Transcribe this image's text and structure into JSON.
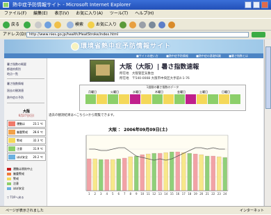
{
  "window": {
    "title": "熱中症予防情報サイト - Microsoft Internet Explorer",
    "menu": [
      "ファイル(F)",
      "編集(E)",
      "表示(V)",
      "お気に入り(A)",
      "ツール(T)",
      "ヘルプ(H)"
    ]
  },
  "toolbar": {
    "back_label": "戻る",
    "search_label": "検索",
    "favorites_label": "お気に入り"
  },
  "address": {
    "label": "アドレス(D)",
    "url": "http://www.nies.go.jp/health/HeatStroke/index.html"
  },
  "banner": {
    "site_title": "環境省熱中症予防情報サイト",
    "nav": [
      "■サイトの使い方",
      "■熱中症予防情報",
      "■熱中症の基礎知識",
      "■暑さ指数とは"
    ]
  },
  "sidebar": {
    "links": [
      "暑さ指数の概要",
      "都道府県別",
      "地点一覧",
      "暑さ指数情報",
      "過去の観測値",
      "熱中症の予防"
    ],
    "city": "大阪",
    "date": "6月27日(日)",
    "heat_rows": [
      {
        "label": "運動は",
        "value": "23.1 ℃"
      },
      {
        "label": "厳重警戒",
        "value": "28.6 ℃"
      },
      {
        "label": "警戒",
        "value": "32.3 ℃"
      },
      {
        "label": "注意",
        "value": "31.9 ℃"
      },
      {
        "label": "ほぼ安全",
        "value": "20.2 ℃"
      }
    ],
    "legend": [
      "運動は原則中止",
      "厳重警戒",
      "警戒",
      "注意",
      "ほぼ安全"
    ],
    "top_link": "▽ TOPへ戻る"
  },
  "main": {
    "place_title": "大阪（大阪）| 暑さ指数速報",
    "address_line1": "所在地　大阪管区気象台",
    "address_line2": "所在地　〒540-0008 大阪市中央区大手前4-1-76",
    "week_head": "1週間の暑さ指数のデータ",
    "week_days": [
      "月曜日",
      "火曜日",
      "水曜日",
      "木曜日",
      "金曜日",
      "土曜日",
      "日曜日"
    ],
    "note": "過去の観測結果は<こちら>から閲覧できます。",
    "chart_title": "大阪 ： 2006年09月09日(土)"
  },
  "status": {
    "left": "ページが表示されました",
    "right": "インターネット"
  },
  "chart_data": {
    "type": "bar",
    "title": "大阪 ： 2006年09月09日(土)",
    "categories": [
      "1",
      "2",
      "3",
      "4",
      "5",
      "6",
      "7",
      "8",
      "9",
      "10",
      "11",
      "12",
      "13",
      "14",
      "15",
      "16",
      "17",
      "18",
      "19",
      "20",
      "21",
      "22",
      "23",
      "24"
    ],
    "series": [
      {
        "values": [
          23,
          23,
          22.5,
          22.5,
          22.5,
          23,
          23.5,
          24.5,
          25,
          26,
          26.5,
          27,
          27,
          27.5,
          28,
          28,
          27.5,
          27,
          26.5,
          26,
          25,
          25,
          24.5,
          24
        ]
      }
    ],
    "ylim": [
      0,
      40
    ],
    "colors": [
      "#f2a2a6",
      "#f7e88a",
      "#8fd07a"
    ],
    "line_values": [
      30,
      30,
      29,
      29,
      30,
      31,
      31,
      28,
      25,
      24,
      23,
      22,
      23,
      22,
      23,
      25,
      27,
      29,
      31,
      31,
      30,
      31,
      30,
      30
    ]
  }
}
